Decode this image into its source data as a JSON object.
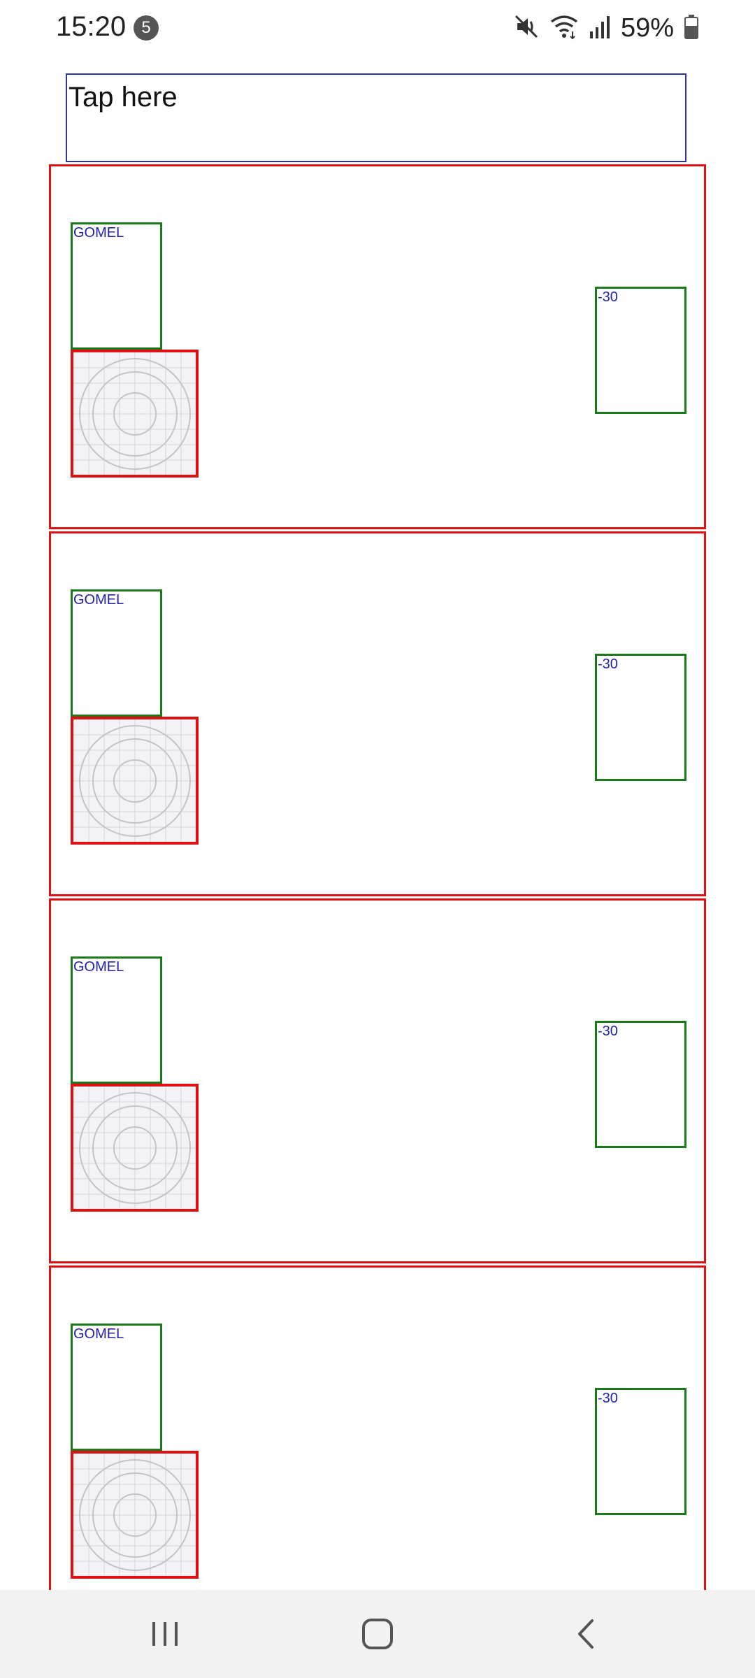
{
  "status_bar": {
    "time": "15:20",
    "notification_count": "5",
    "battery": "59%",
    "icons": [
      "mute-icon",
      "wifi-icon",
      "signal-icon",
      "battery-icon"
    ]
  },
  "tap_box": {
    "label": "Tap here"
  },
  "cards": [
    {
      "city": "GOMEL",
      "temp": "-30"
    },
    {
      "city": "GOMEL",
      "temp": "-30"
    },
    {
      "city": "GOMEL",
      "temp": "-30"
    },
    {
      "city": "GOMEL",
      "temp": "-30"
    }
  ],
  "nav_bar": {
    "buttons": [
      "recents-icon",
      "home-icon",
      "back-icon"
    ]
  },
  "colors": {
    "card_border": "#dd1111",
    "text_box_border": "#1a7a1a",
    "value_text": "#2222aa",
    "tap_border": "#2b3a8f"
  }
}
